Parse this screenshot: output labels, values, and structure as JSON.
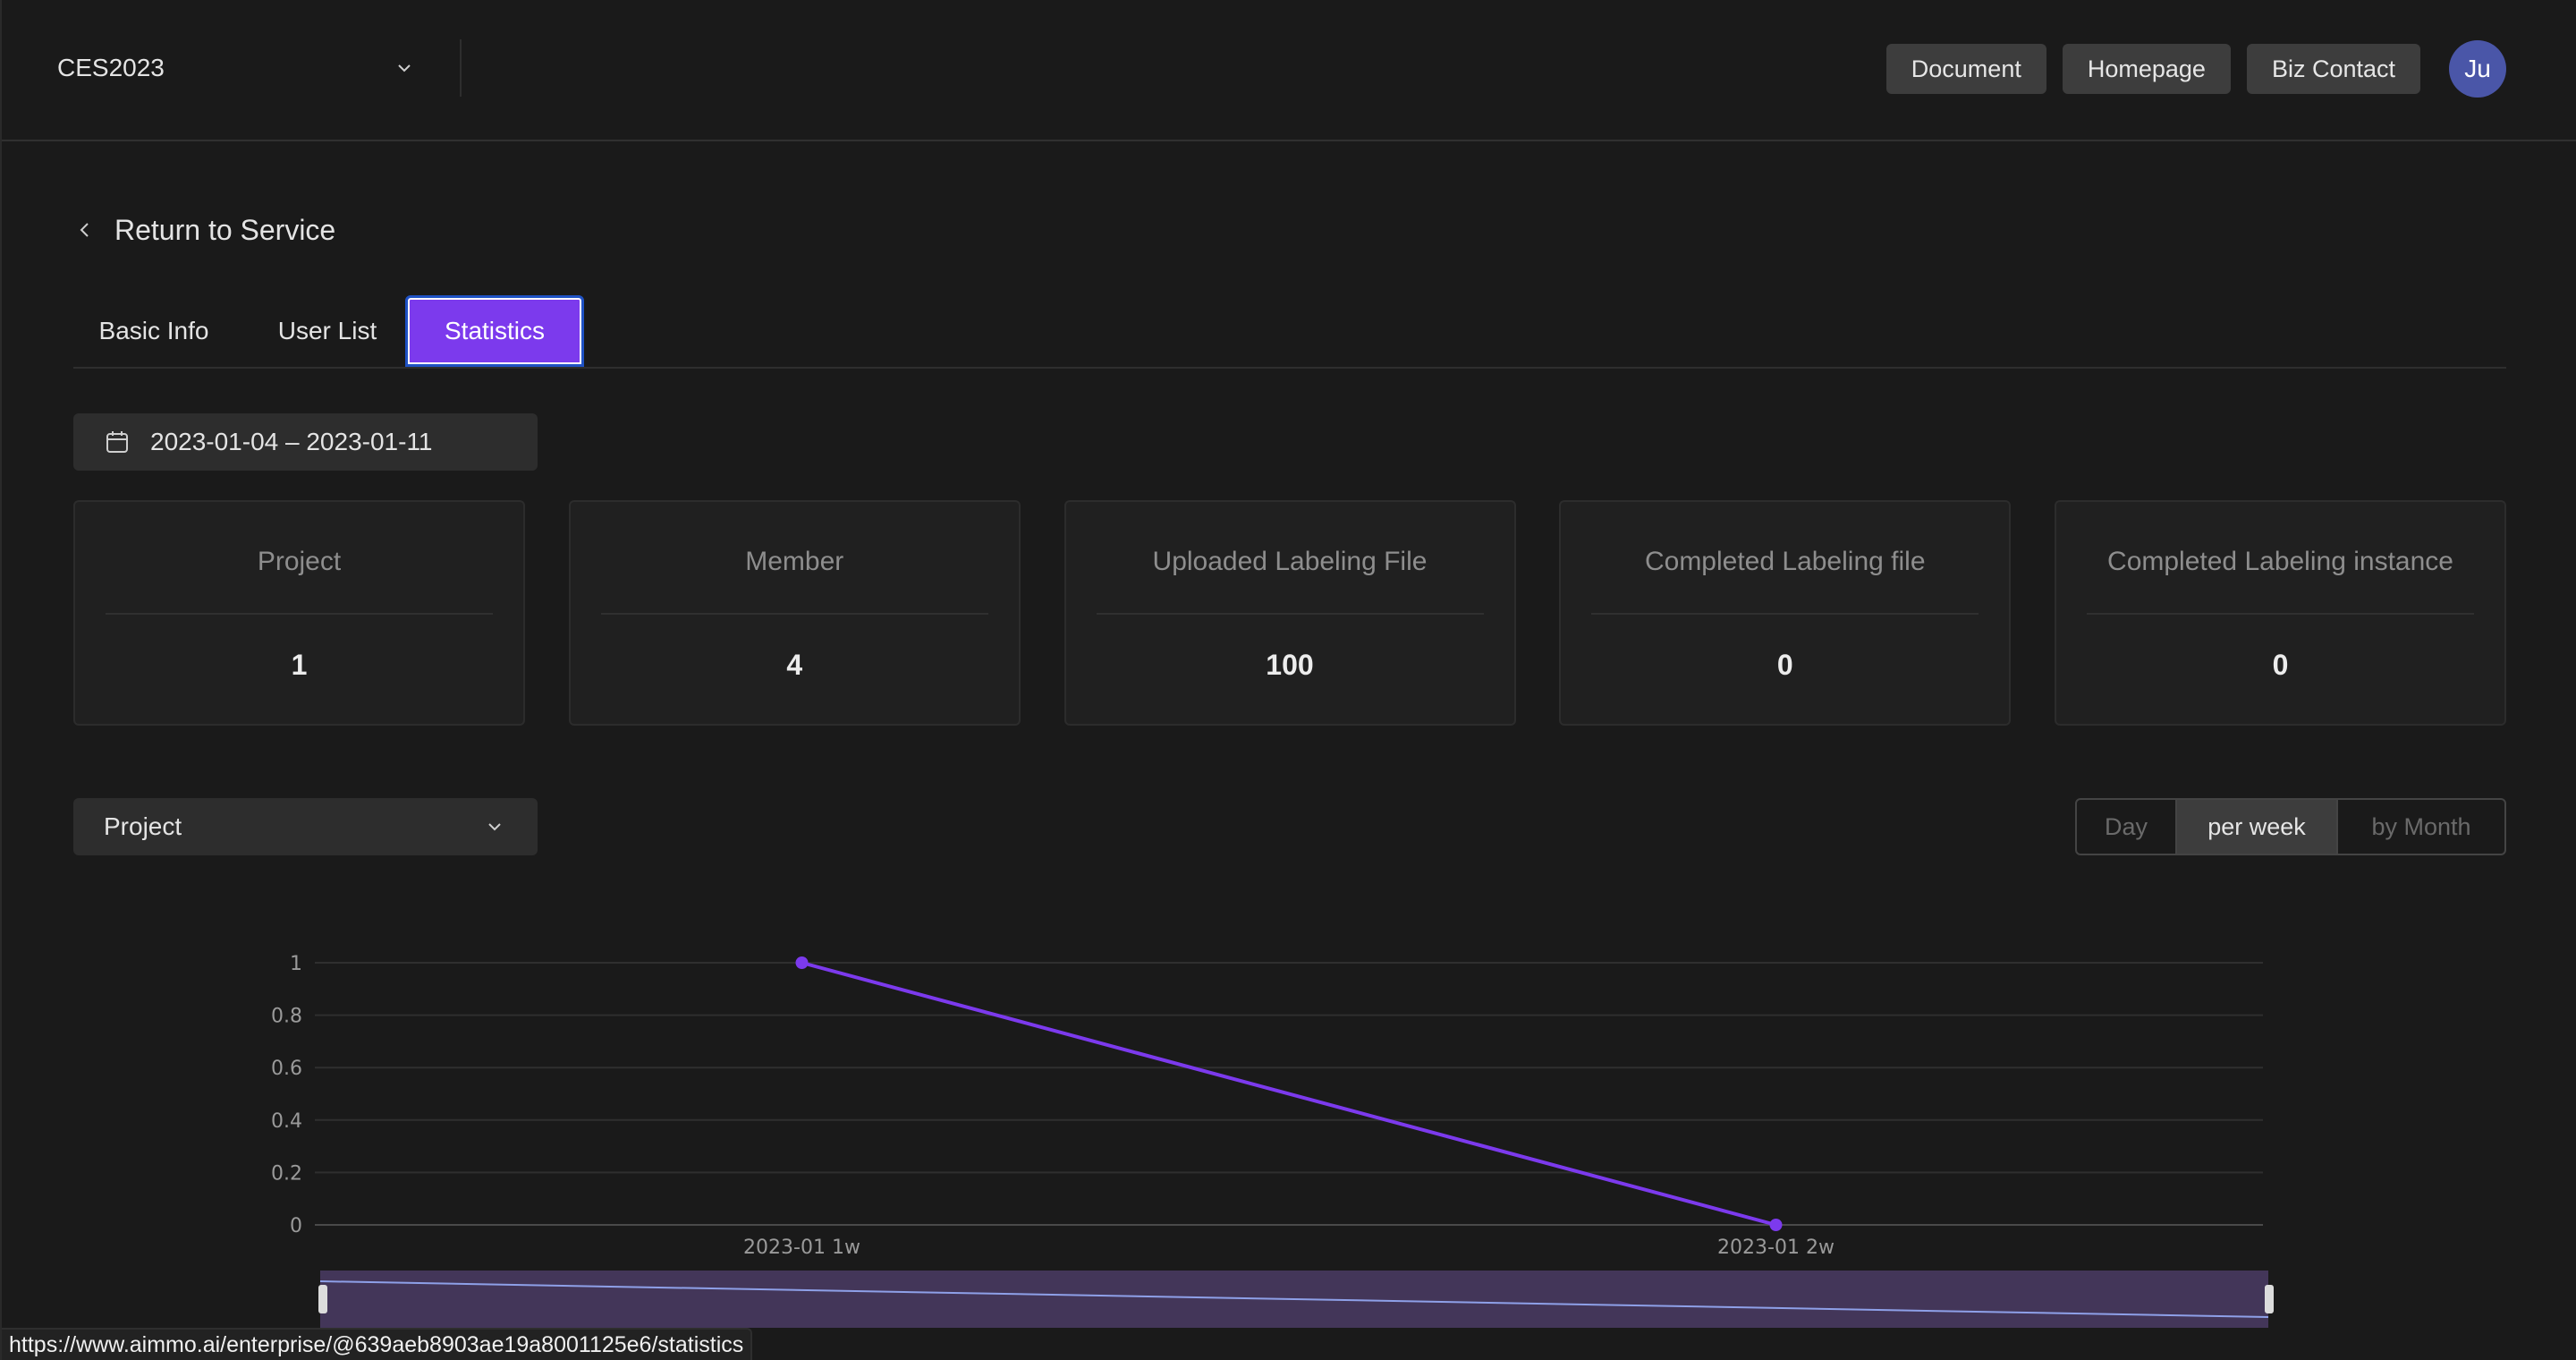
{
  "header": {
    "project_select": "CES2023",
    "buttons": [
      "Document",
      "Homepage",
      "Biz Contact"
    ],
    "avatar_initials": "Ju",
    "avatar_color": "#4a56a8"
  },
  "back_link": "Return to Service",
  "tabs": [
    {
      "label": "Basic Info",
      "active": false
    },
    {
      "label": "User List",
      "active": false
    },
    {
      "label": "Statistics",
      "active": true
    }
  ],
  "accent_color": "#7c3aed",
  "date_range": "2023-01-04 – 2023-01-11",
  "stats": [
    {
      "title": "Project",
      "value": "1"
    },
    {
      "title": "Member",
      "value": "4"
    },
    {
      "title": "Uploaded Labeling File",
      "value": "100"
    },
    {
      "title": "Completed Labeling file",
      "value": "0"
    },
    {
      "title": "Completed Labeling instance",
      "value": "0"
    }
  ],
  "chart_select": "Project",
  "period_options": [
    {
      "label": "Day",
      "selected": false
    },
    {
      "label": "per week",
      "selected": true
    },
    {
      "label": "by Month",
      "selected": false
    }
  ],
  "chart_data": {
    "type": "line",
    "title": "",
    "xlabel": "",
    "ylabel": "",
    "categories": [
      "2023-01 1w",
      "2023-01 2w"
    ],
    "series": [
      {
        "name": "Project",
        "values": [
          1,
          0
        ],
        "color": "#7c3aed"
      }
    ],
    "ylim": [
      0,
      1
    ],
    "yticks": [
      "0",
      "0.2",
      "0.4",
      "0.6",
      "0.8",
      "1"
    ],
    "grid": true,
    "legend": "none",
    "data_zoom": {
      "start_percent": 0,
      "end_percent": 100
    }
  },
  "status_url": "https://www.aimmo.ai/enterprise/@639aeb8903ae19a8001125e6/statistics"
}
